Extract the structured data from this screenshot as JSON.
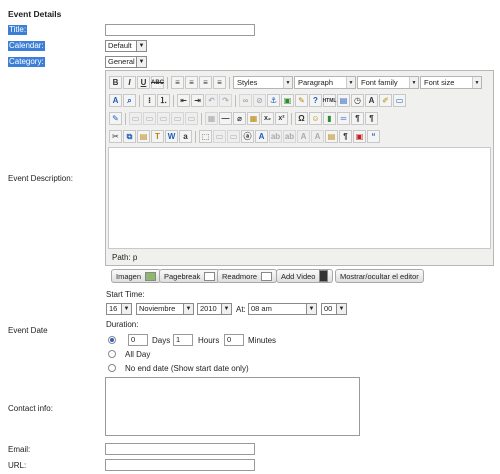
{
  "section_title": "Event Details",
  "fields": {
    "title_label": "Title:",
    "calendar_label": "Calendar:",
    "calendar_value": "Default",
    "category_label": "Category:",
    "category_value": "General",
    "description_label": "Event Description:",
    "event_date_label": "Event Date",
    "contact_label": "Contact info:",
    "email_label": "Email:",
    "url_label": "URL:"
  },
  "editor": {
    "styles": "Styles",
    "paragraph": "Paragraph",
    "font_family": "Font family",
    "font_size": "Font size",
    "path": "Path: p",
    "buttons": {
      "image": "Imagen",
      "pagebreak": "Pagebreak",
      "readmore": "Readmore",
      "add_video": "Add Video",
      "toggle_editor": "Mostrar/ocultar el editor"
    }
  },
  "date": {
    "start_time_label": "Start Time:",
    "day": "16",
    "month": "Noviembre",
    "year": "2010",
    "at_label": "At:",
    "hour": "08 am",
    "minute": "00",
    "duration_label": "Duration:",
    "days_value": "0",
    "days_label": "Days",
    "hours_value": "1",
    "hours_label": "Hours",
    "minutes_value": "0",
    "minutes_label": "Minutes",
    "all_day_label": "All Day",
    "no_end_label": "No end date (Show start date only)"
  }
}
